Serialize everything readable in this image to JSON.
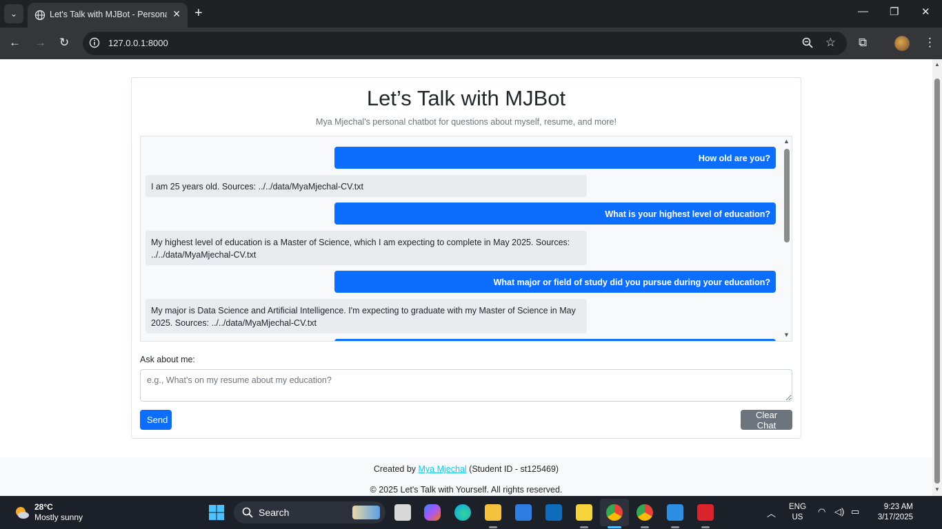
{
  "browser": {
    "tab_title": "Let's Talk with MJBot - Personal",
    "url": "127.0.0.1:8000",
    "new_tab_label": "+",
    "tab_close": "✕"
  },
  "app": {
    "title": "Let’s Talk with MJBot",
    "subtitle": "Mya Mjechal's personal chatbot for questions about myself, resume, and more!",
    "messages": [
      {
        "role": "user",
        "text": "How old are you?"
      },
      {
        "role": "bot",
        "text": "I am 25 years old. Sources: ../../data/MyaMjechal-CV.txt"
      },
      {
        "role": "user",
        "text": "What is your highest level of education?"
      },
      {
        "role": "bot",
        "text": "My highest level of education is a Master of Science, which I am expecting to complete in May 2025. Sources: ../../data/MyaMjechal-CV.txt"
      },
      {
        "role": "user",
        "text": "What major or field of study did you pursue during your education?"
      },
      {
        "role": "bot",
        "text": "My major is Data Science and Artificial Intelligence. I'm expecting to graduate with my Master of Science in May 2025. Sources: ../../data/MyaMjechal-CV.txt"
      }
    ],
    "ask_label": "Ask about me:",
    "ask_placeholder": "e.g., What's on my resume about my education?",
    "send_label": "Send",
    "clear_label": "Clear Chat"
  },
  "footer": {
    "created_prefix": "Created by ",
    "author": "Mya Mjechal",
    "created_suffix": " (Student ID - st125469)",
    "copyright": "© 2025 Let's Talk with Yourself. All rights reserved."
  },
  "taskbar": {
    "temperature": "28°C",
    "weather": "Mostly sunny",
    "search_label": "Search",
    "lang_1": "ENG",
    "lang_2": "US",
    "time": "9:23 AM",
    "date": "3/17/2025"
  },
  "colors": {
    "primary": "#0d6efd",
    "secondary": "#6c757d",
    "bot_bubble": "#e9ecef",
    "link": "#0dcaf0"
  }
}
